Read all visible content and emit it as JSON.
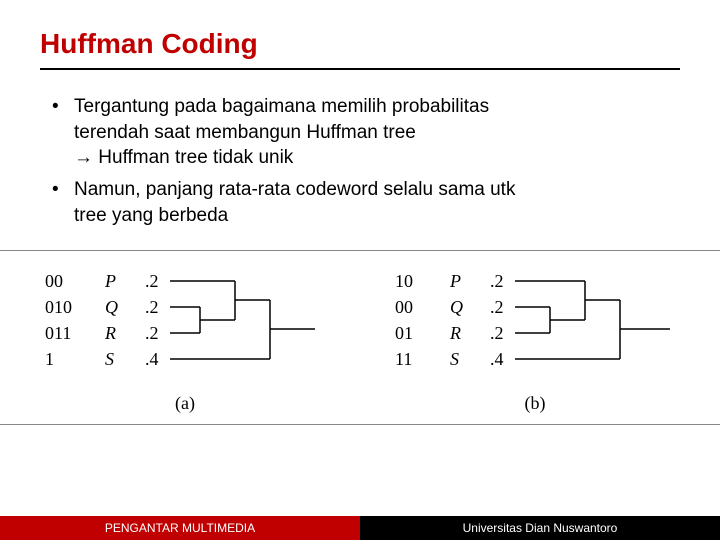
{
  "title": "Huffman Coding",
  "bullets": [
    {
      "line1": "Tergantung pada bagaimana memilih probabilitas",
      "line2": "terendah saat membangun Huffman tree",
      "line3_arrow": "→",
      "line3": "Huffman tree tidak unik"
    },
    {
      "line1": "Namun, panjang rata-rata codeword selalu sama utk",
      "line2": "tree yang berbeda"
    }
  ],
  "trees": [
    {
      "caption": "(a)",
      "rows": [
        {
          "code": "00",
          "sym": "P",
          "prob": ".2"
        },
        {
          "code": "010",
          "sym": "Q",
          "prob": ".2"
        },
        {
          "code": "011",
          "sym": "R",
          "prob": ".2"
        },
        {
          "code": "1",
          "sym": "S",
          "prob": ".4"
        }
      ]
    },
    {
      "caption": "(b)",
      "rows": [
        {
          "code": "10",
          "sym": "P",
          "prob": ".2"
        },
        {
          "code": "00",
          "sym": "Q",
          "prob": ".2"
        },
        {
          "code": "01",
          "sym": "R",
          "prob": ".2"
        },
        {
          "code": "11",
          "sym": "S",
          "prob": ".4"
        }
      ]
    }
  ],
  "footer": {
    "left": "PENGANTAR MULTIMEDIA",
    "right": "Universitas Dian Nuswantoro"
  }
}
